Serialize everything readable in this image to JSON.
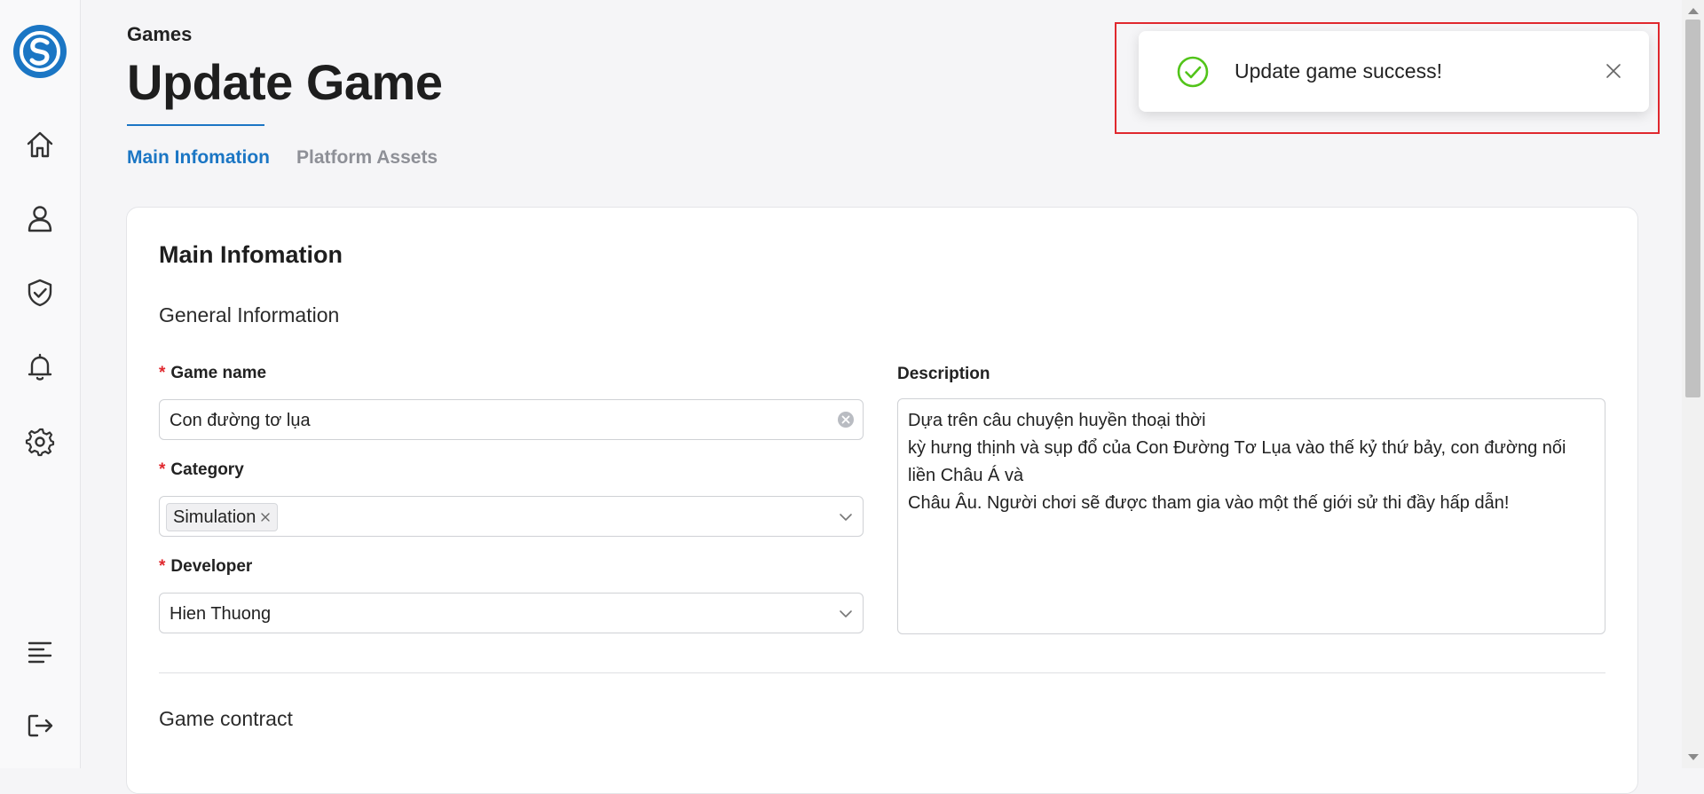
{
  "sidebar": {
    "icons": [
      "logo-icon",
      "home-icon",
      "user-icon",
      "shield-check-icon",
      "bell-icon",
      "gear-icon",
      "menu-lines-icon",
      "logout-icon"
    ]
  },
  "header": {
    "breadcrumb": "Games",
    "title": "Update Game"
  },
  "tabs": [
    {
      "label": "Main Infomation",
      "active": true
    },
    {
      "label": "Platform Assets",
      "active": false
    }
  ],
  "main": {
    "card_title": "Main Infomation",
    "general_section": "General Information",
    "fields": {
      "game_name": {
        "label": "Game name",
        "required": true,
        "value": "Con đường tơ lụa"
      },
      "category": {
        "label": "Category",
        "required": true,
        "tags": [
          "Simulation"
        ]
      },
      "developer": {
        "label": "Developer",
        "required": true,
        "value": "Hien Thuong"
      },
      "description": {
        "label": "Description",
        "value": "Dựa trên câu chuyện huyền thoại thời\nkỳ hưng thịnh và sụp đổ của Con Đường Tơ Lụa vào thế kỷ thứ bảy, con đường nối liền Châu Á và\nChâu Âu. Người chơi sẽ được tham gia vào một thế giới sử thi đầy hấp dẫn!"
      }
    },
    "contract_section": "Game contract"
  },
  "notification": {
    "message": "Update game success!",
    "type": "success",
    "highlighted": true
  },
  "colors": {
    "primary": "#1b76c4",
    "required": "#e0282e",
    "success": "#52c41a",
    "highlight": "#e0282e"
  }
}
